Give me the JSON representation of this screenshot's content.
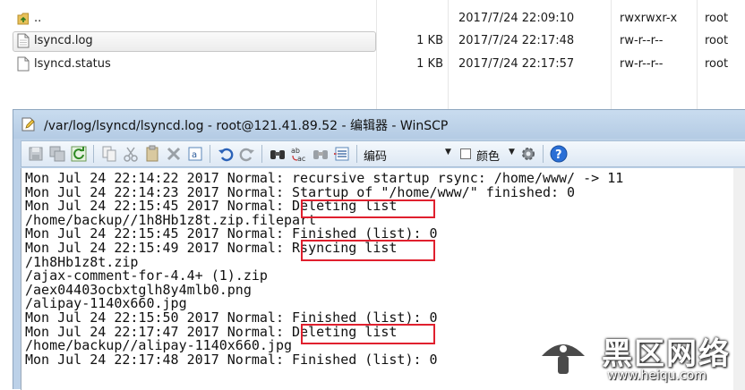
{
  "file_list": {
    "rows": [
      {
        "name": "..",
        "icon": "folder-up-icon",
        "size": "",
        "date": "2017/7/24 22:09:10",
        "perm": "rwxrwxr-x",
        "owner": "root",
        "selected": false
      },
      {
        "name": "lsyncd.log",
        "icon": "file-icon",
        "size": "1 KB",
        "date": "2017/7/24 22:17:48",
        "perm": "rw-r--r--",
        "owner": "root",
        "selected": true
      },
      {
        "name": "lsyncd.status",
        "icon": "file-icon",
        "size": "1 KB",
        "date": "2017/7/24 22:17:57",
        "perm": "rw-r--r--",
        "owner": "root",
        "selected": false
      }
    ]
  },
  "editor": {
    "title": "/var/log/lsyncd/lsyncd.log - root@121.41.89.52 - 编辑器 - WinSCP",
    "toolbar": {
      "encoding_label": "编码",
      "color_label": "颜色"
    },
    "lines": [
      "Mon Jul 24 22:14:22 2017 Normal: recursive startup rsync: /home/www/ -> 11",
      "Mon Jul 24 22:14:23 2017 Normal: Startup of \"/home/www/\" finished: 0",
      "Mon Jul 24 22:15:45 2017 Normal: Deleting list",
      "/home/backup//1h8Hb1z8t.zip.filepart",
      "Mon Jul 24 22:15:45 2017 Normal: Finished (list): 0",
      "Mon Jul 24 22:15:49 2017 Normal: Rsyncing list",
      "/1h8Hb1z8t.zip",
      "/ajax-comment-for-4.4+ (1).zip",
      "/aex04403ocbxtglh8y4mlb0.png",
      "/alipay-1140x660.jpg",
      "Mon Jul 24 22:15:50 2017 Normal: Finished (list): 0",
      "Mon Jul 24 22:17:47 2017 Normal: Deleting list",
      "/home/backup//alipay-1140x660.jpg",
      "Mon Jul 24 22:17:48 2017 Normal: Finished (list): 0"
    ]
  },
  "watermark": {
    "name": "黑区网络",
    "url": "www.heiqu.com"
  },
  "colors": {
    "highlight_box": "#e0202e",
    "title_bar": "#bcd1e8",
    "help_button": "#2a6fd6"
  }
}
